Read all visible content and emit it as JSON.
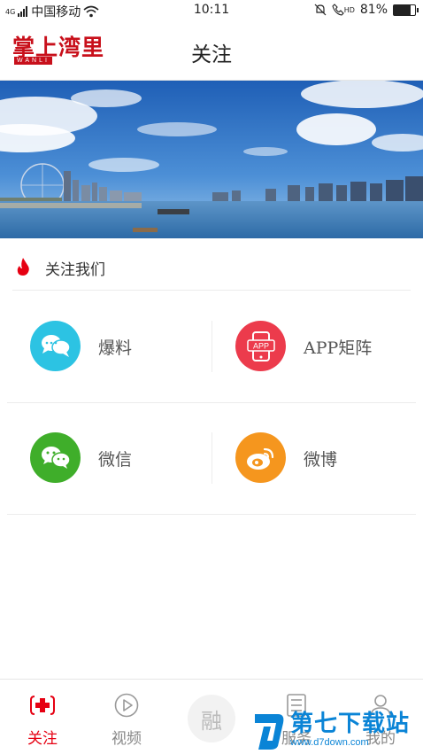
{
  "status_bar": {
    "network": "4G",
    "carrier": "中国移动",
    "time": "10:11",
    "hd": "HD",
    "battery": "81%",
    "battery_level": 0.81
  },
  "header": {
    "logo_text": "掌上湾里",
    "logo_sub": "WANLI",
    "title": "关注"
  },
  "section": {
    "title": "关注我们"
  },
  "grid": [
    {
      "label": "爆料",
      "color": "#2cc3e3",
      "icon": "chat-bubble-icon"
    },
    {
      "label": "APP矩阵",
      "color": "#ec3b4c",
      "icon": "app-phone-icon",
      "badge": "APP"
    },
    {
      "label": "微信",
      "color": "#3fae2a",
      "icon": "wechat-icon"
    },
    {
      "label": "微博",
      "color": "#f5961e",
      "icon": "weibo-icon"
    }
  ],
  "tabbar": {
    "items": [
      {
        "label": "关注",
        "icon": "medical-cross-icon",
        "active": true
      },
      {
        "label": "视频",
        "icon": "play-icon",
        "active": false
      },
      {
        "label": "融",
        "icon": "fusion-icon",
        "active": false
      },
      {
        "label": "服务",
        "icon": "list-icon",
        "active": false
      },
      {
        "label": "我的",
        "icon": "user-icon",
        "active": false
      }
    ]
  },
  "watermark": {
    "text": "第七下载站",
    "url": "www.d7down.com"
  },
  "colors": {
    "accent": "#e60012",
    "logo": "#c8101b"
  }
}
